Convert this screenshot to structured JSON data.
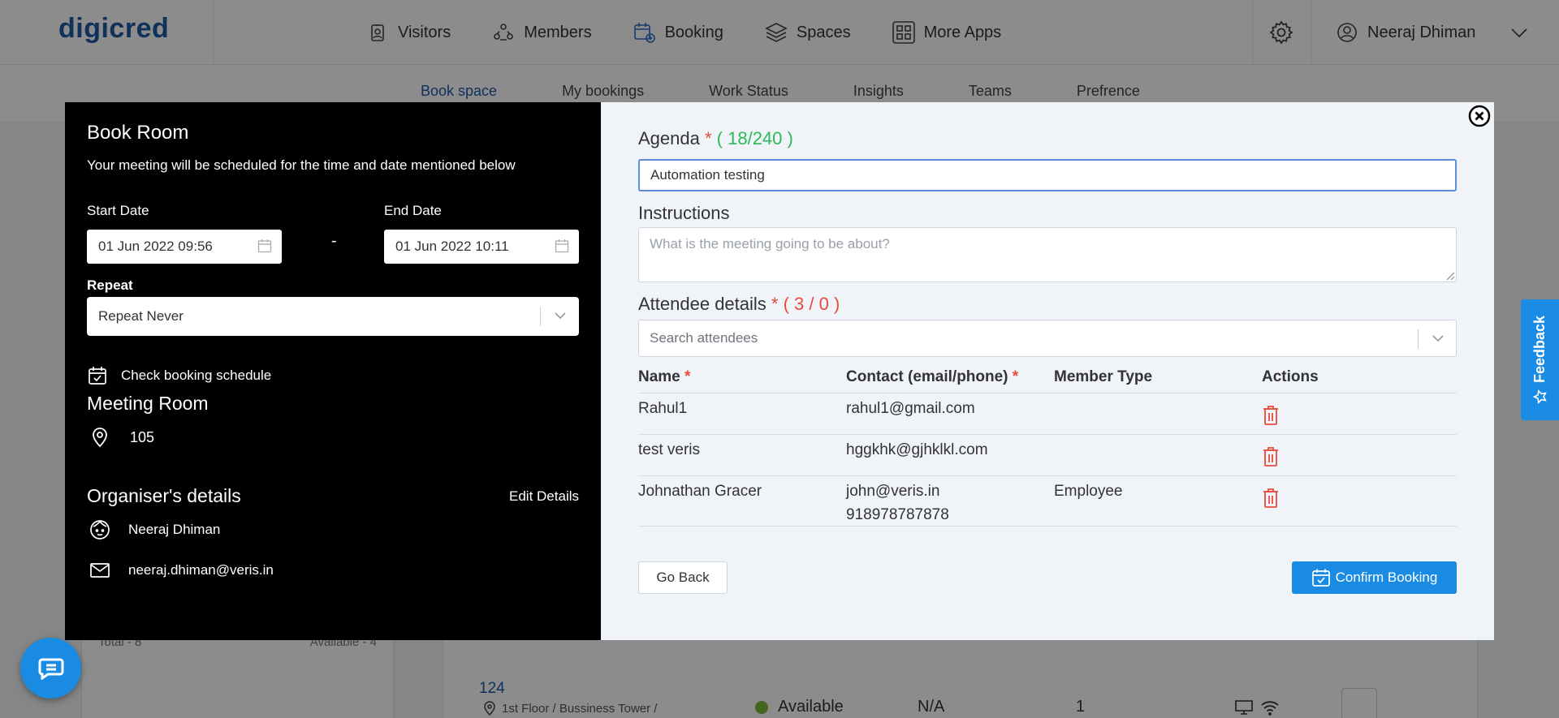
{
  "app": {
    "logo": "digicred"
  },
  "nav": {
    "items": [
      {
        "label": "Visitors",
        "icon": "visitor-badge-icon"
      },
      {
        "label": "Members",
        "icon": "members-icon"
      },
      {
        "label": "Booking",
        "icon": "booking-calendar-icon"
      },
      {
        "label": "Spaces",
        "icon": "layers-icon"
      },
      {
        "label": "More Apps",
        "icon": "apps-grid-icon"
      }
    ],
    "user_name": "Neeraj Dhiman"
  },
  "subnav": {
    "items": [
      "Book space",
      "My bookings",
      "Work Status",
      "Insights",
      "Teams",
      "Prefrence"
    ],
    "active": "Book space"
  },
  "background": {
    "total": "Total - 8",
    "available_count": "Available - 4",
    "room_number": "124",
    "location": "1st Floor / Bussiness Tower /",
    "status": "Available",
    "na": "N/A",
    "count": "1"
  },
  "modal": {
    "left": {
      "title": "Book Room",
      "subtitle": "Your meeting will be scheduled for the time and date mentioned below",
      "start_label": "Start Date",
      "start_value": "01 Jun 2022 09:56",
      "dash": "-",
      "end_label": "End Date",
      "end_value": "01 Jun 2022 10:11",
      "repeat_label": "Repeat",
      "repeat_value": "Repeat Never",
      "check_schedule": "Check booking schedule",
      "room_title": "Meeting Room",
      "room_value": "105",
      "organiser_title": "Organiser's details",
      "edit_details": "Edit Details",
      "organiser_name": "Neeraj Dhiman",
      "organiser_email": "neeraj.dhiman@veris.in"
    },
    "right": {
      "agenda_label": "Agenda",
      "agenda_req": "*",
      "agenda_count": "( 18/240 )",
      "agenda_value": "Automation testing",
      "instructions_label": "Instructions",
      "instructions_placeholder": "What is the meeting going to be about?",
      "attendee_label": "Attendee details",
      "attendee_req": "*",
      "attendee_count": "( 3 / 0 )",
      "search_placeholder": "Search attendees",
      "columns": {
        "name": "Name",
        "contact": "Contact (email/phone)",
        "member_type": "Member Type",
        "actions": "Actions",
        "req": "*"
      },
      "rows": [
        {
          "name": "Rahul1",
          "contact": "rahul1@gmail.com",
          "phone": "",
          "member_type": ""
        },
        {
          "name": "test veris",
          "contact": "hggkhk@gjhklkl.com",
          "phone": "",
          "member_type": ""
        },
        {
          "name": "Johnathan Gracer",
          "contact": "john@veris.in",
          "phone": "918978787878",
          "member_type": "Employee"
        }
      ],
      "go_back": "Go Back",
      "confirm": "Confirm Booking"
    }
  },
  "feedback": {
    "label": "Feedback"
  },
  "colors": {
    "brand_blue": "#1a8be3",
    "logo_blue": "#1d5aa8",
    "required_red": "#e84b3c",
    "count_green": "#2eb85c",
    "delete_red": "#e84b3c"
  }
}
